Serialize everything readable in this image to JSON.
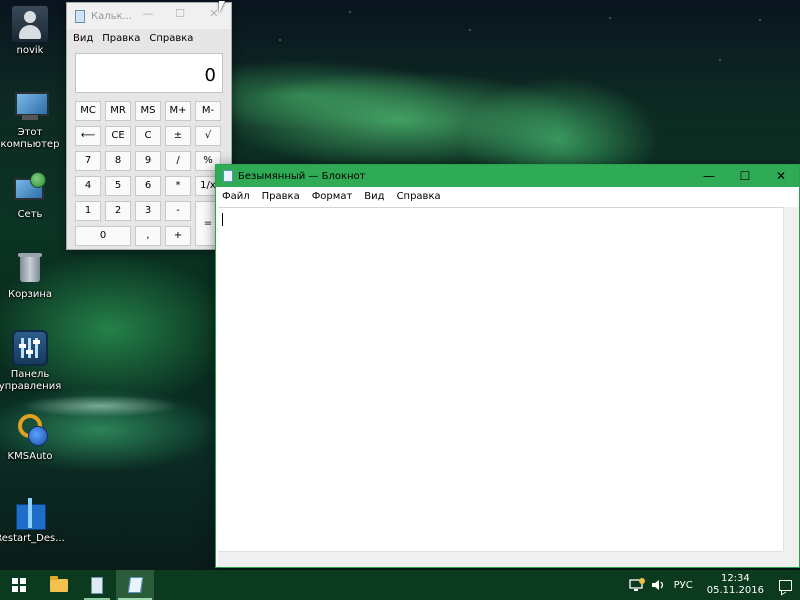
{
  "desktop": {
    "icons": [
      {
        "label": "novik",
        "icon": "user-folder-icon"
      },
      {
        "label": "Этот компьютер",
        "icon": "computer-icon"
      },
      {
        "label": "Сеть",
        "icon": "network-icon"
      },
      {
        "label": "Корзина",
        "icon": "recycle-bin-icon"
      },
      {
        "label": "Панель управления",
        "icon": "control-panel-icon"
      },
      {
        "label": "KMSAuto",
        "icon": "kmsauto-icon"
      },
      {
        "label": "Restart_Des...",
        "icon": "gift-box-icon"
      }
    ]
  },
  "calculator": {
    "title": "Кальк...",
    "menu": [
      "Вид",
      "Правка",
      "Справка"
    ],
    "display": "0",
    "memory_row": [
      "MC",
      "MR",
      "MS",
      "M+",
      "M-"
    ],
    "row2": [
      "⟵",
      "CE",
      "C",
      "±",
      "√"
    ],
    "row3": [
      "7",
      "8",
      "9",
      "/",
      "%"
    ],
    "row4": [
      "4",
      "5",
      "6",
      "*",
      "1/x"
    ],
    "row5": [
      "1",
      "2",
      "3",
      "-",
      "="
    ],
    "row6": [
      "0",
      ",",
      "+"
    ]
  },
  "notepad": {
    "title": "Безымянный — Блокнот",
    "menu": [
      "Файл",
      "Правка",
      "Формат",
      "Вид",
      "Справка"
    ],
    "minimize": "—",
    "maximize": "☐",
    "close": "✕",
    "content": ""
  },
  "taskbar": {
    "language": "РУС",
    "time": "12:34",
    "date": "05.11.2016",
    "accent_color": "#2faa55"
  }
}
